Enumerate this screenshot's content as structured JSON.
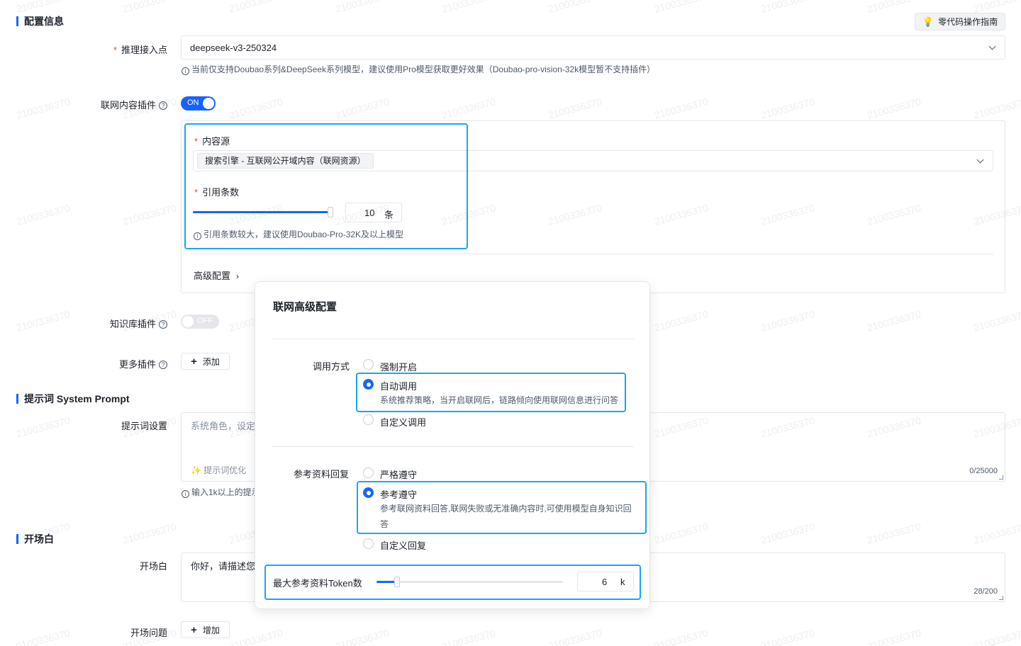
{
  "watermark": "2100336370",
  "sections": {
    "config": "配置信息",
    "prompt": "提示词 System Prompt",
    "opening": "开场白"
  },
  "guide_button": "零代码操作指南",
  "inference": {
    "label": "推理接入点",
    "value": "deepseek-v3-250324",
    "hint": "当前仅支持Doubao系列&DeepSeek系列模型，建议使用Pro模型获取更好效果（Doubao-pro-vision-32k模型暂不支持插件）"
  },
  "web_plugin": {
    "label": "联网内容插件",
    "switch": "ON",
    "content_source_label": "内容源",
    "content_source_value": "搜索引擎 - 互联网公开域内容（联网资源）",
    "quote_label": "引用条数",
    "quote_value": "10",
    "quote_unit": "条",
    "quote_fraction": 0.99,
    "quote_hint": "引用条数较大，建议使用Doubao-Pro-32K及以上模型",
    "advanced": "高级配置"
  },
  "kb_plugin": {
    "label": "知识库插件",
    "switch": "OFF"
  },
  "more_plugins": {
    "label": "更多插件",
    "button": "添加"
  },
  "prompt": {
    "label": "提示词设置",
    "placeholder": "系统角色，设定",
    "optimize": "提示词优化",
    "count": "0/25000",
    "hint": "输入1k以上的提示"
  },
  "opening": {
    "label": "开场白",
    "value": "你好，请描述您",
    "count": "28/200",
    "questions_label": "开场问题",
    "questions_button": "增加"
  },
  "popover": {
    "title": "联网高级配置",
    "call_mode_label": "调用方式",
    "call_options": [
      {
        "label": "强制开启",
        "desc": "",
        "checked": false
      },
      {
        "label": "自动调用",
        "desc": "系统推荐策略，当开启联网后，链路倾向使用联网信息进行问答",
        "checked": true
      },
      {
        "label": "自定义调用",
        "desc": "",
        "checked": false
      }
    ],
    "reference_label": "参考资料回复",
    "reference_options": [
      {
        "label": "严格遵守",
        "desc": "",
        "checked": false
      },
      {
        "label": "参考遵守",
        "desc": "参考联网资料回答,联网失败或无准确内容时,可使用模型自身知识回答",
        "checked": true
      },
      {
        "label": "自定义回复",
        "desc": "",
        "checked": false
      }
    ],
    "token_label": "最大参考资料Token数",
    "token_value": "6",
    "token_unit": "k",
    "token_fraction": 0.11
  },
  "colors": {
    "primary": "#1664ff",
    "highlight": "#1aa7ee",
    "required": "#f53f3f"
  }
}
